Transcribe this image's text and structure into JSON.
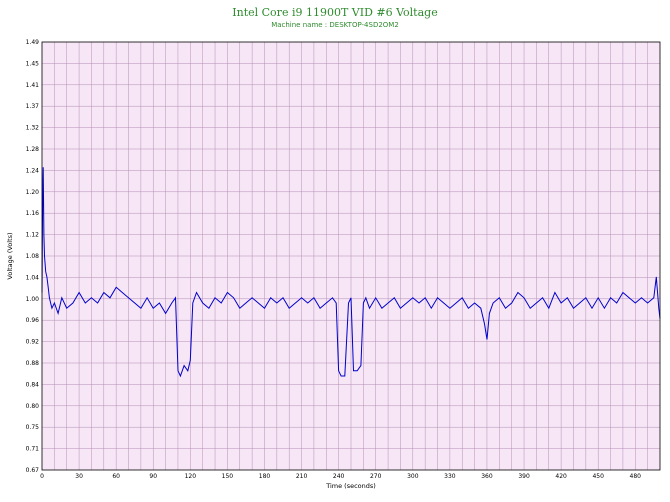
{
  "chart_data": {
    "type": "line",
    "title": "Intel Core i9 11900T VID #6 Voltage",
    "subtitle": "Machine name : DESKTOP-4SD2OM2",
    "xlabel": "Time (seconds)",
    "ylabel": "Voltage (Volts)",
    "xlim": [
      0,
      500
    ],
    "ylim": [
      0.67,
      1.49
    ],
    "x_ticks": [
      "0",
      "30",
      "60",
      "90",
      "120",
      "150",
      "180",
      "210",
      "240",
      "270",
      "300",
      "330",
      "360",
      "390",
      "420",
      "450",
      "480"
    ],
    "y_ticks": [
      "0.67",
      "0.71",
      "0.75",
      "0.80",
      "0.84",
      "0.88",
      "0.92",
      "0.96",
      "1.00",
      "1.04",
      "1.08",
      "1.12",
      "1.16",
      "1.20",
      "1.24",
      "1.28",
      "1.32",
      "1.37",
      "1.41",
      "1.45",
      "1.49"
    ],
    "grid": true,
    "colors": {
      "line": "#0000cc",
      "plot_background": "#f6e6f6",
      "grid": "#b58fb5",
      "title": "#2e8b2e"
    },
    "series": [
      {
        "name": "",
        "x": [
          0,
          0.5,
          1,
          1.5,
          2,
          3,
          4,
          5,
          6,
          8,
          10,
          13,
          16,
          20,
          25,
          30,
          35,
          40,
          45,
          50,
          55,
          60,
          65,
          70,
          75,
          80,
          85,
          90,
          95,
          100,
          105,
          108,
          110,
          112,
          115,
          118,
          120,
          122,
          125,
          130,
          135,
          140,
          145,
          150,
          155,
          160,
          165,
          170,
          175,
          180,
          185,
          190,
          195,
          200,
          205,
          210,
          215,
          220,
          225,
          230,
          235,
          238,
          240,
          242,
          245,
          248,
          250,
          252,
          255,
          258,
          260,
          262,
          265,
          270,
          275,
          280,
          285,
          290,
          295,
          300,
          305,
          310,
          315,
          320,
          325,
          330,
          335,
          340,
          345,
          350,
          355,
          358,
          360,
          362,
          365,
          370,
          375,
          380,
          385,
          390,
          395,
          400,
          405,
          410,
          415,
          420,
          425,
          430,
          435,
          440,
          445,
          450,
          455,
          460,
          465,
          470,
          475,
          480,
          485,
          490,
          495,
          497,
          499,
          500
        ],
        "y": [
          1.01,
          1.18,
          1.25,
          1.12,
          1.08,
          1.05,
          1.04,
          1.02,
          1.0,
          0.98,
          0.99,
          0.97,
          1.0,
          0.98,
          0.99,
          1.01,
          0.99,
          1.0,
          0.99,
          1.01,
          1.0,
          1.02,
          1.01,
          1.0,
          0.99,
          0.98,
          1.0,
          0.98,
          0.99,
          0.97,
          0.99,
          1.0,
          0.86,
          0.85,
          0.87,
          0.86,
          0.88,
          0.99,
          1.01,
          0.99,
          0.98,
          1.0,
          0.99,
          1.01,
          1.0,
          0.98,
          0.99,
          1.0,
          0.99,
          0.98,
          1.0,
          0.99,
          1.0,
          0.98,
          0.99,
          1.0,
          0.99,
          1.0,
          0.98,
          0.99,
          1.0,
          0.99,
          0.86,
          0.85,
          0.85,
          0.99,
          1.0,
          0.86,
          0.86,
          0.87,
          0.99,
          1.0,
          0.98,
          1.0,
          0.98,
          0.99,
          1.0,
          0.98,
          0.99,
          1.0,
          0.99,
          1.0,
          0.98,
          1.0,
          0.99,
          0.98,
          0.99,
          1.0,
          0.98,
          0.99,
          0.98,
          0.95,
          0.92,
          0.97,
          0.99,
          1.0,
          0.98,
          0.99,
          1.01,
          1.0,
          0.98,
          0.99,
          1.0,
          0.98,
          1.01,
          0.99,
          1.0,
          0.98,
          0.99,
          1.0,
          0.98,
          1.0,
          0.98,
          1.0,
          0.99,
          1.01,
          1.0,
          0.99,
          1.0,
          0.99,
          1.0,
          1.04,
          0.98,
          0.96
        ]
      }
    ]
  }
}
